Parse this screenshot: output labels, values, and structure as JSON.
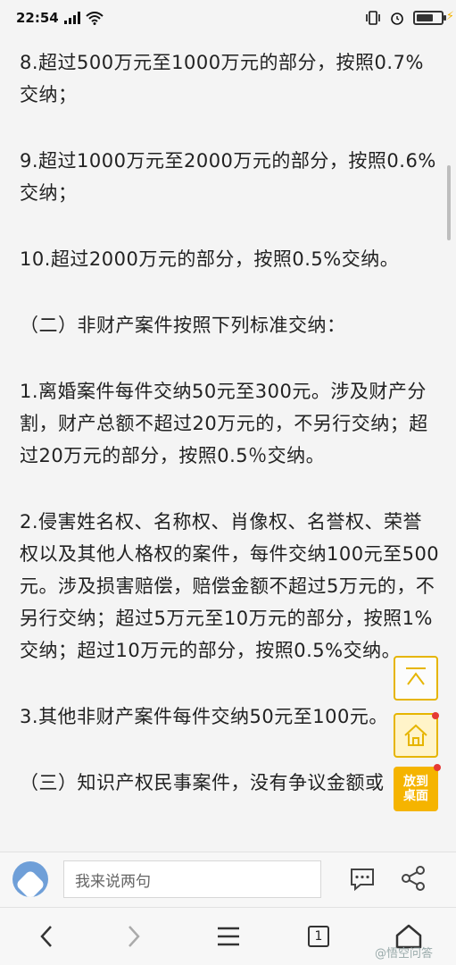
{
  "status_bar": {
    "time": "22:54",
    "signal_icon": "signal-icon",
    "wifi_icon": "wifi-icon",
    "right_icons": [
      "vibrate-icon",
      "alarm-icon",
      "battery-icon"
    ]
  },
  "article": {
    "paragraphs": [
      "8.超过500万元至1000万元的部分，按照0.7%交纳；",
      "9.超过1000万元至2000万元的部分，按照0.6%交纳；",
      "10.超过2000万元的部分，按照0.5%交纳。",
      "（二）非财产案件按照下列标准交纳：",
      "1.离婚案件每件交纳50元至300元。涉及财产分割，财产总额不超过20万元的，不另行交纳；超过20万元的部分，按照0.5％交纳。",
      "2.侵害姓名权、名称权、肖像权、名誉权、荣誉权以及其他人格权的案件，每件交纳100元至500元。涉及损害赔偿，赔偿金额不超过5万元的，不另行交纳；超过5万元至10万元的部分，按照1%交纳；超过10万元的部分，按照0.5%交纳。",
      "3.其他非财产案件每件交纳50元至100元。",
      "（三）知识产权民事案件，没有争议金额或"
    ]
  },
  "side_buttons": {
    "desktop_label_1": "放到",
    "desktop_label_2": "桌面"
  },
  "comment_bar": {
    "placeholder": "我来说两句"
  },
  "bottom_nav": {
    "tab_count": "1"
  },
  "watermark": "@悟空问答"
}
